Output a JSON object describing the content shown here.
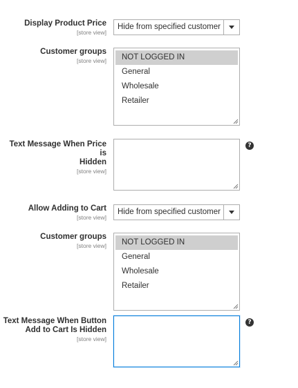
{
  "fields": {
    "display_price": {
      "label": "Display Product Price",
      "scope": "[store view]",
      "value": "Hide from specified customer"
    },
    "groups1": {
      "label": "Customer groups",
      "scope": "[store view]",
      "options": [
        "NOT LOGGED IN",
        "General",
        "Wholesale",
        "Retailer"
      ],
      "selected": "NOT LOGGED IN"
    },
    "price_msg": {
      "label_line1": "Text Message When Price is",
      "label_line2": "Hidden",
      "scope": "[store view]",
      "value": ""
    },
    "allow_cart": {
      "label": "Allow Adding to Cart",
      "scope": "[store view]",
      "value": "Hide from specified customer"
    },
    "groups2": {
      "label": "Customer groups",
      "scope": "[store view]",
      "options": [
        "NOT LOGGED IN",
        "General",
        "Wholesale",
        "Retailer"
      ],
      "selected": "NOT LOGGED IN"
    },
    "cart_msg": {
      "label_line1": "Text Message When Button",
      "label_line2": "Add to Cart Is Hidden",
      "scope": "[store view]",
      "value": ""
    }
  },
  "help_icon_glyph": "?",
  "colors": {
    "selected_option": "#cfcfcf",
    "focus_border": "#007bdb",
    "border": "#adadad"
  }
}
